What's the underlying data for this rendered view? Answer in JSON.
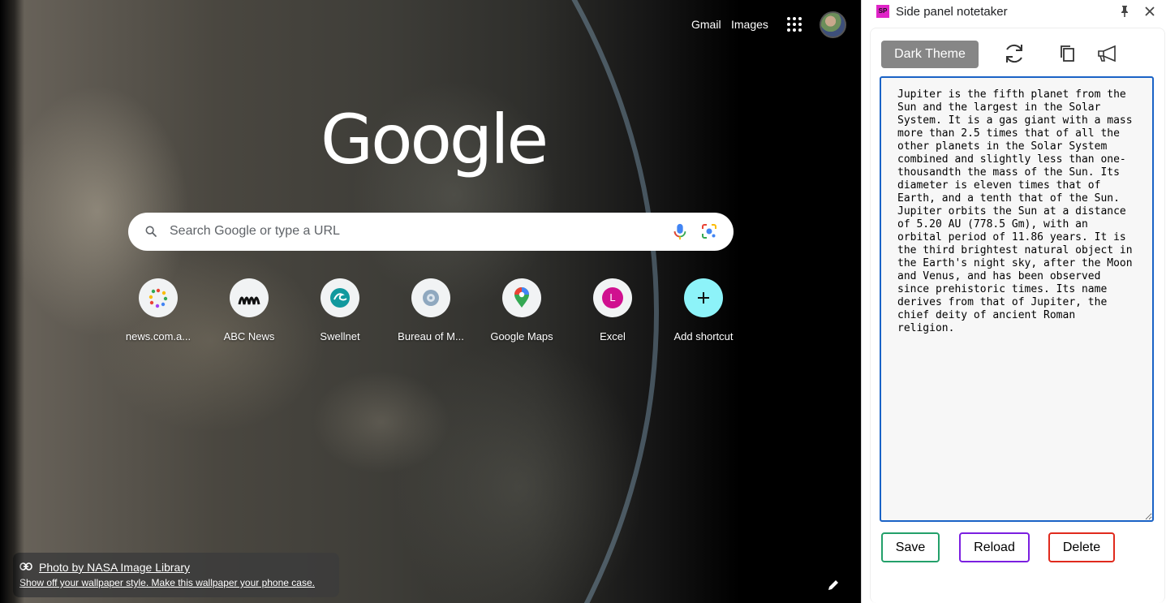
{
  "ntp": {
    "gmail": "Gmail",
    "images": "Images",
    "logo_text": "Google",
    "search_placeholder": "Search Google or type a URL",
    "shortcuts": [
      {
        "label": "news.com.a...",
        "icon": "news-icon"
      },
      {
        "label": "ABC News",
        "icon": "abc-icon"
      },
      {
        "label": "Swellnet",
        "icon": "swellnet-icon"
      },
      {
        "label": "Bureau of M...",
        "icon": "bom-icon"
      },
      {
        "label": "Google Maps",
        "icon": "maps-pin-icon"
      },
      {
        "label": "Excel",
        "icon": "letter-avatar-icon",
        "letter": "L"
      },
      {
        "label": "Add shortcut",
        "icon": "plus-icon"
      }
    ],
    "attribution": {
      "credit": "Photo by NASA Image Library",
      "wallpaper_link": "Show off your wallpaper style. Make this wallpaper your phone case."
    }
  },
  "side_panel": {
    "ext_logo": "SP",
    "title": "Side panel notetaker",
    "dark_theme_label": "Dark Theme",
    "notes": "Jupiter is the fifth planet from the Sun and the largest in the Solar System. It is a gas giant with a mass more than 2.5 times that of all the other planets in the Solar System combined and slightly less than one-thousandth the mass of the Sun. Its diameter is eleven times that of Earth, and a tenth that of the Sun. Jupiter orbits the Sun at a distance of 5.20 AU (778.5 Gm), with an orbital period of 11.86 years. It is the third brightest natural object in the Earth's night sky, after the Moon and Venus, and has been observed since prehistoric times. Its name derives from that of Jupiter, the chief deity of ancient Roman religion.",
    "save_label": "Save",
    "reload_label": "Reload",
    "delete_label": "Delete"
  },
  "colors": {
    "save_border": "#23a06a",
    "reload_border": "#7b1fe0",
    "delete_border": "#e02a1d",
    "textarea_focus": "#1a63c6",
    "add_shortcut_tile": "#8df3f9",
    "excel_avatar": "#d0108f"
  }
}
